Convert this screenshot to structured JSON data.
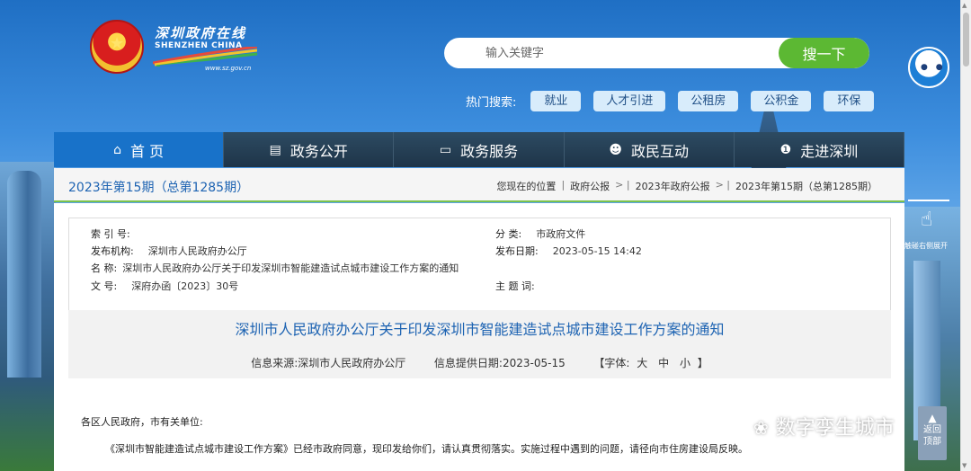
{
  "header": {
    "site_cn": "深圳政府在线",
    "site_en": "SHENZHEN CHINA",
    "site_url": "www.sz.gov.cn"
  },
  "search": {
    "placeholder": "输入关键字",
    "button": "搜一下"
  },
  "hot_search": {
    "label": "热门搜索:",
    "tags": [
      "就业",
      "人才引进",
      "公租房",
      "公积金",
      "环保"
    ]
  },
  "nav": [
    {
      "label": "首 页",
      "icon": "home-icon"
    },
    {
      "label": "政务公开",
      "icon": "news-icon"
    },
    {
      "label": "政务服务",
      "icon": "monitor-icon"
    },
    {
      "label": "政民互动",
      "icon": "people-icon"
    },
    {
      "label": "走进深圳",
      "icon": "info-icon"
    }
  ],
  "issue": "2023年第15期（总第1285期）",
  "breadcrumb": [
    "您现在的位置",
    "政府公报",
    "2023年政府公报",
    "2023年第15期（总第1285期）"
  ],
  "meta": {
    "index_label": "索 引 号:",
    "index_value": "",
    "category_label": "分 类:",
    "category_value": "市政府文件",
    "org_label": "发布机构:",
    "org_value": "深圳市人民政府办公厅",
    "date_label": "发布日期:",
    "date_value": "2023-05-15 14:42",
    "name_label": "名 称:",
    "name_value": "深圳市人民政府办公厅关于印发深圳市智能建造试点城市建设工作方案的通知",
    "docno_label": "文 号:",
    "docno_value": "深府办函〔2023〕30号",
    "subject_label": "主 题 词:",
    "subject_value": ""
  },
  "doc": {
    "title": "深圳市人民政府办公厅关于印发深圳市智能建造试点城市建设工作方案的通知",
    "source_label": "信息来源:",
    "source_value": "深圳市人民政府办公厅",
    "provide_label": "信息提供日期:",
    "provide_value": "2023-05-15",
    "font_label": "【字体:",
    "font_large": "大",
    "font_medium": "中",
    "font_small": "小",
    "font_close": "】",
    "salutation": "各区人民政府，市有关单位:",
    "para1": "《深圳市智能建造试点城市建设工作方案》已经市政府同意，现印发给你们，请认真贯彻落实。实施过程中遇到的问题，请径向市住房建设局反映。"
  },
  "side": {
    "touch_text": "触碰右侧展开",
    "back_top_1": "返回",
    "back_top_2": "顶部"
  },
  "watermark": "数字孪生城市"
}
